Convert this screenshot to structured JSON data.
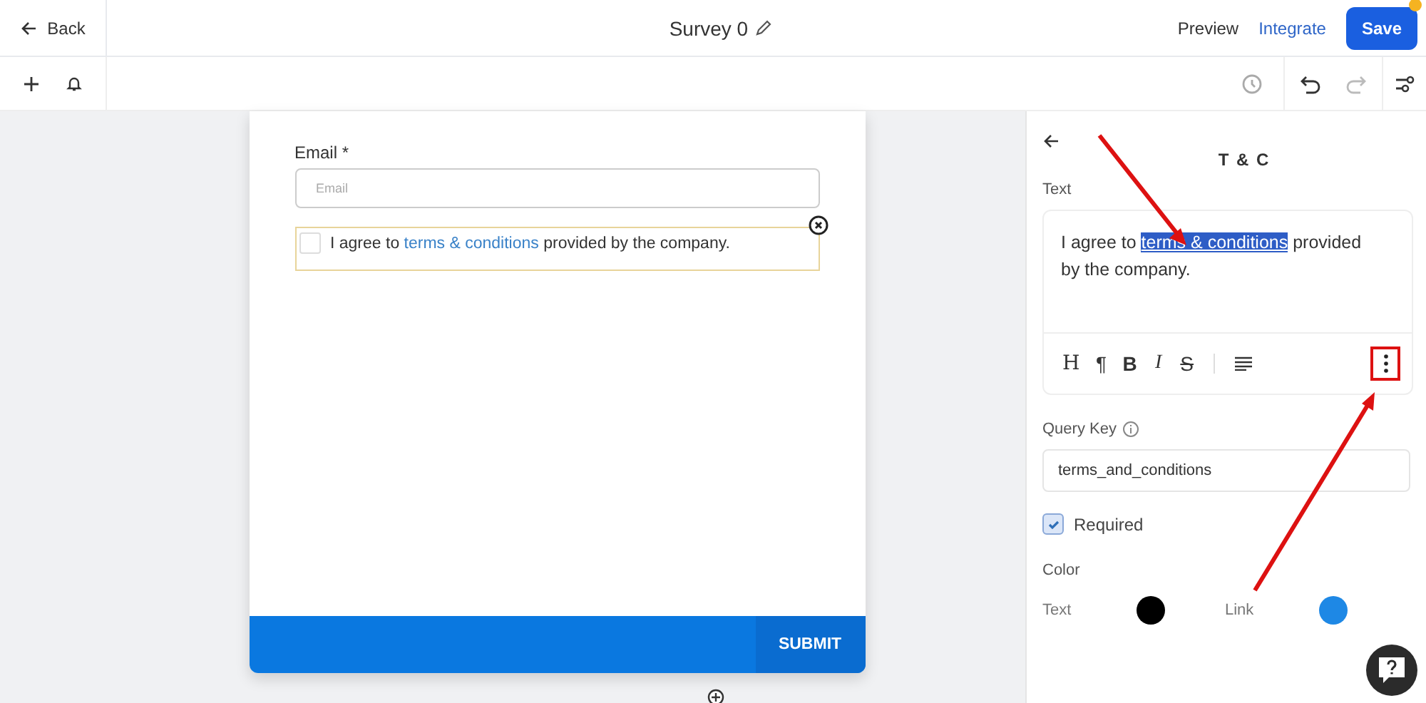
{
  "header": {
    "back": "Back",
    "title": "Survey 0",
    "preview": "Preview",
    "integrate": "Integrate",
    "save": "Save",
    "unsaved": true
  },
  "form": {
    "email_label": "Email *",
    "email_placeholder": "Email",
    "agreement": {
      "checked": false,
      "before": "I agree to ",
      "link": "terms & conditions",
      "after": " provided by the company."
    },
    "submit": "SUBMIT"
  },
  "panel": {
    "title": "T & C",
    "text_label": "Text",
    "editor": {
      "before": "I agree to ",
      "link": "terms & conditions",
      "link_selected": true,
      "after": " provided by the company."
    },
    "tools": [
      {
        "kind": "heading",
        "label": "H"
      },
      {
        "kind": "paragraph",
        "label": "¶"
      },
      {
        "kind": "bold",
        "label": "B"
      },
      {
        "kind": "italic",
        "label": "I"
      },
      {
        "kind": "strike",
        "label": "S"
      },
      {
        "kind": "align"
      }
    ],
    "query_key_label": "Query Key",
    "query_key": "terms_and_conditions",
    "required": {
      "label": "Required",
      "checked": true
    },
    "color_label": "Color",
    "colors": [
      {
        "label": "Text",
        "color": "#000000"
      },
      {
        "label": "Link",
        "color": "#1e88e5"
      }
    ]
  }
}
